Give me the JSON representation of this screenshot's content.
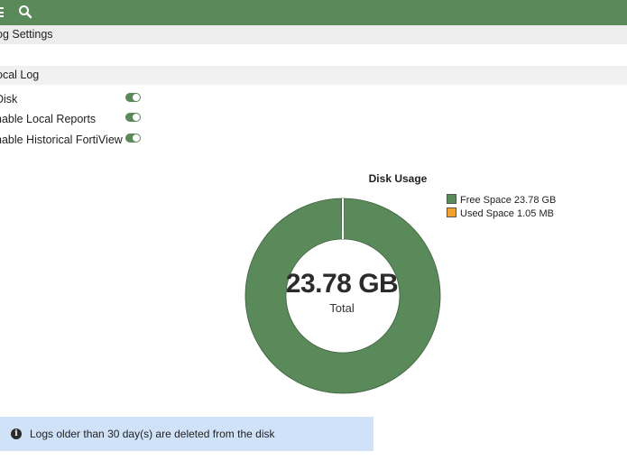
{
  "topbar": {
    "icons": [
      "menu-icon",
      "search-icon"
    ],
    "color": "#5a8a5a"
  },
  "sections": {
    "log_settings": "og Settings",
    "local_log": "ocal Log"
  },
  "settings": [
    {
      "label": "Disk",
      "enabled": true
    },
    {
      "label": "nable Local Reports",
      "enabled": true
    },
    {
      "label": "nable Historical FortiView",
      "enabled": true
    }
  ],
  "chart_data": {
    "type": "pie",
    "title": "Disk Usage",
    "center_value": "23.78 GB",
    "center_label": "Total",
    "series": [
      {
        "name": "Free Space 23.78 GB",
        "value": 23.78,
        "unit": "GB",
        "color": "#5a8a5a"
      },
      {
        "name": "Used Space 1.05 MB",
        "value": 0.001,
        "unit": "GB",
        "color": "#f0a030"
      }
    ],
    "legend_position": "top-right"
  },
  "banner": {
    "icon": "info-icon",
    "text": "Logs older than 30 day(s) are deleted from the disk"
  }
}
